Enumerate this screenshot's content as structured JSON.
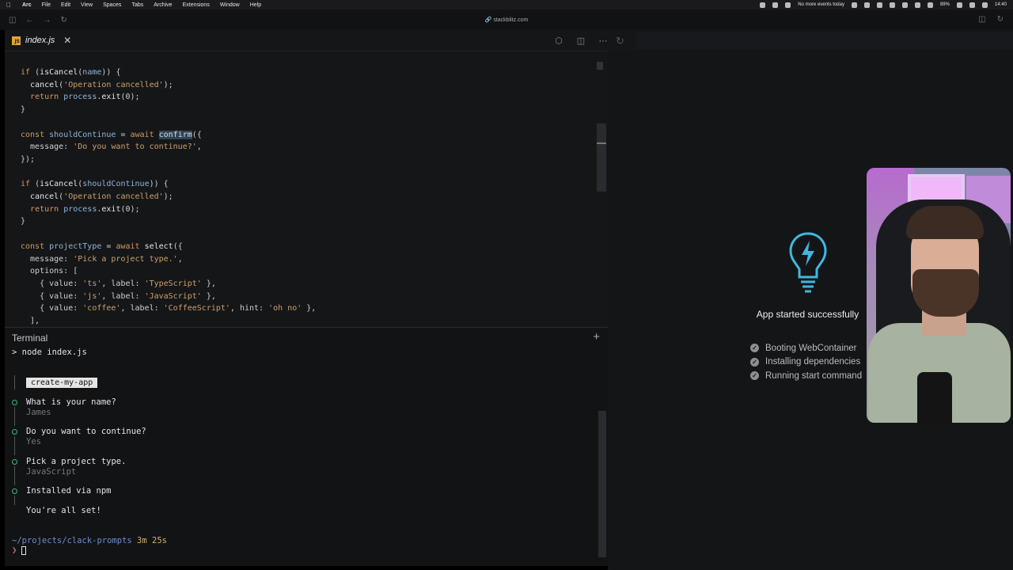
{
  "menubar": {
    "items": [
      "Arc",
      "File",
      "Edit",
      "View",
      "Spaces",
      "Tabs",
      "Archive",
      "Extensions",
      "Window",
      "Help"
    ],
    "status_events": "No more events today",
    "battery": "89%",
    "clock": "14:40"
  },
  "browser": {
    "url": "stackblitz.com"
  },
  "editor": {
    "tab_label": "index.js",
    "tab_icon": "JS",
    "code_lines": [
      [
        [
          "kw",
          "if"
        ],
        [
          "plain",
          " ("
        ],
        [
          "fn",
          "isCancel"
        ],
        [
          "plain",
          "("
        ],
        [
          "var",
          "name"
        ],
        [
          "plain",
          ")) {"
        ]
      ],
      [
        [
          "plain",
          "  "
        ],
        [
          "fn",
          "cancel"
        ],
        [
          "plain",
          "("
        ],
        [
          "str",
          "'Operation cancelled'"
        ],
        [
          "plain",
          ");"
        ]
      ],
      [
        [
          "plain",
          "  "
        ],
        [
          "kw",
          "return"
        ],
        [
          "plain",
          " "
        ],
        [
          "var",
          "process"
        ],
        [
          "plain",
          "."
        ],
        [
          "fn",
          "exit"
        ],
        [
          "plain",
          "(0);"
        ]
      ],
      [
        [
          "plain",
          "}"
        ]
      ],
      [
        [
          "plain",
          ""
        ]
      ],
      [
        [
          "kw",
          "const"
        ],
        [
          "plain",
          " "
        ],
        [
          "var",
          "shouldContinue"
        ],
        [
          "plain",
          " = "
        ],
        [
          "kw",
          "await"
        ],
        [
          "plain",
          " "
        ],
        [
          "hl",
          "confirm"
        ],
        [
          "plain",
          "({"
        ]
      ],
      [
        [
          "plain",
          "  message: "
        ],
        [
          "str",
          "'Do you want to continue?'"
        ],
        [
          "plain",
          ","
        ]
      ],
      [
        [
          "plain",
          "});"
        ]
      ],
      [
        [
          "plain",
          ""
        ]
      ],
      [
        [
          "kw",
          "if"
        ],
        [
          "plain",
          " ("
        ],
        [
          "fn",
          "isCancel"
        ],
        [
          "plain",
          "("
        ],
        [
          "var",
          "shouldContinue"
        ],
        [
          "plain",
          ")) {"
        ]
      ],
      [
        [
          "plain",
          "  "
        ],
        [
          "fn",
          "cancel"
        ],
        [
          "plain",
          "("
        ],
        [
          "str",
          "'Operation cancelled'"
        ],
        [
          "plain",
          ");"
        ]
      ],
      [
        [
          "plain",
          "  "
        ],
        [
          "kw",
          "return"
        ],
        [
          "plain",
          " "
        ],
        [
          "var",
          "process"
        ],
        [
          "plain",
          "."
        ],
        [
          "fn",
          "exit"
        ],
        [
          "plain",
          "(0);"
        ]
      ],
      [
        [
          "plain",
          "}"
        ]
      ],
      [
        [
          "plain",
          ""
        ]
      ],
      [
        [
          "kw",
          "const"
        ],
        [
          "plain",
          " "
        ],
        [
          "var",
          "projectType"
        ],
        [
          "plain",
          " = "
        ],
        [
          "kw",
          "await"
        ],
        [
          "plain",
          " "
        ],
        [
          "fn",
          "select"
        ],
        [
          "plain",
          "({"
        ]
      ],
      [
        [
          "plain",
          "  message: "
        ],
        [
          "str",
          "'Pick a project type.'"
        ],
        [
          "plain",
          ","
        ]
      ],
      [
        [
          "plain",
          "  options: ["
        ]
      ],
      [
        [
          "plain",
          "    { value: "
        ],
        [
          "str",
          "'ts'"
        ],
        [
          "plain",
          ", label: "
        ],
        [
          "str",
          "'TypeScript'"
        ],
        [
          "plain",
          " },"
        ]
      ],
      [
        [
          "plain",
          "    { value: "
        ],
        [
          "str",
          "'js'"
        ],
        [
          "plain",
          ", label: "
        ],
        [
          "str",
          "'JavaScript'"
        ],
        [
          "plain",
          " },"
        ]
      ],
      [
        [
          "plain",
          "    { value: "
        ],
        [
          "str",
          "'coffee'"
        ],
        [
          "plain",
          ", label: "
        ],
        [
          "str",
          "'CoffeeScript'"
        ],
        [
          "plain",
          ", hint: "
        ],
        [
          "str",
          "'oh no'"
        ],
        [
          "plain",
          " },"
        ]
      ],
      [
        [
          "plain",
          "  ],"
        ]
      ]
    ]
  },
  "terminal": {
    "title": "Terminal",
    "add_label": "+",
    "command": "> node index.js",
    "app_badge": "create-my-app",
    "q1": "What is your name?",
    "a1": "James",
    "q2": "Do you want to continue?",
    "a2": "Yes",
    "q3": "Pick a project type.",
    "a3": "JavaScript",
    "installed": "Installed via npm",
    "done": "You're all set!",
    "prompt_path": "~/projects/clack-prompts",
    "prompt_time": "3m 25s"
  },
  "preview": {
    "status": "App started successfully",
    "steps": [
      "Booting WebContainer",
      "Installing dependencies",
      "Running start command"
    ]
  },
  "colors": {
    "accent_bulb": "#3fb7e0",
    "success_green": "#3dba6d"
  }
}
